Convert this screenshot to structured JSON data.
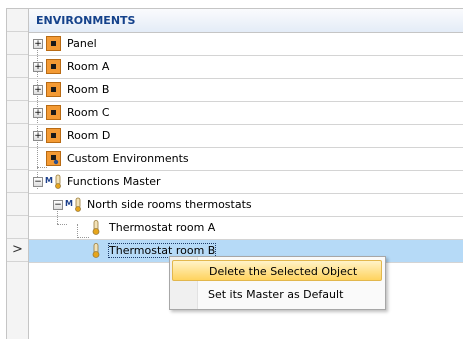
{
  "header": {
    "title": "ENVIRONMENTS"
  },
  "tree": {
    "panel": "Panel",
    "room_a": "Room A",
    "room_b": "Room B",
    "room_c": "Room C",
    "room_d": "Room D",
    "custom": "Custom Environments",
    "functions_master": "Functions Master",
    "north_side": "North side rooms thermostats",
    "thermostat_a": "Thermostat room A",
    "thermostat_b": "Thermostat room B",
    "expand_glyph": "+",
    "collapse_glyph": "−"
  },
  "row_indicator": ">",
  "context_menu": {
    "delete": "Delete the Selected Object",
    "set_master": "Set its Master as Default"
  },
  "colors": {
    "panel_icon": "#f39a34",
    "selection": "#b6daf7",
    "menu_highlight": "#ffd35e",
    "header_text": "#15428b"
  },
  "icons": {
    "panel": "panel-icon",
    "custom_env": "custom-environment-icon",
    "master": "functions-master-icon",
    "thermostat": "thermometer-icon"
  }
}
